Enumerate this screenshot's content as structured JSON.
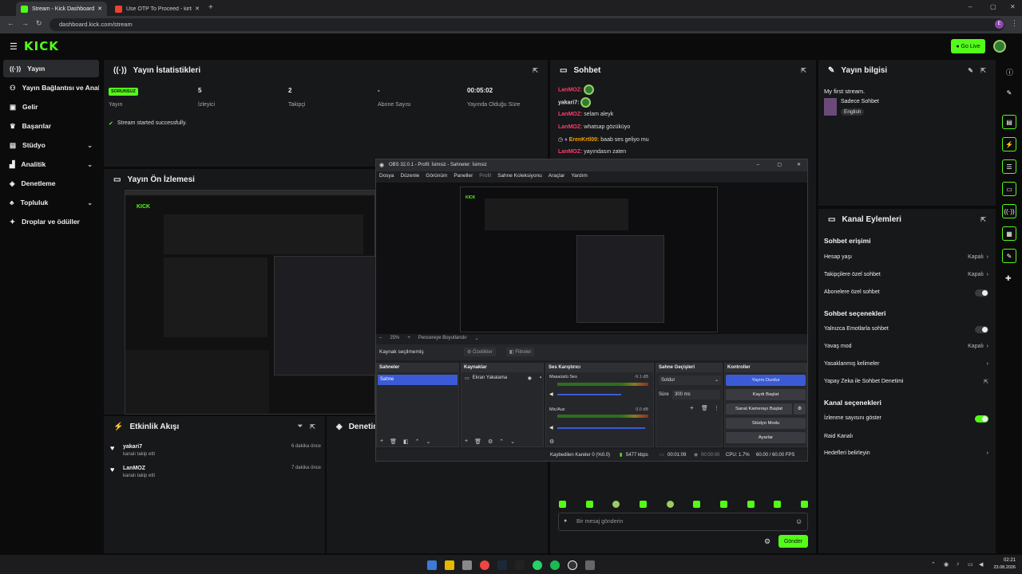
{
  "browser": {
    "tabs": [
      {
        "title": "Stream - Kick Dashboard"
      },
      {
        "title": "Use OTP To Proceed - kirtileren..."
      }
    ],
    "url": "dashboard.kick.com/stream",
    "profile_initial": "E"
  },
  "header": {
    "logo": "KICK",
    "go_live": "Go Live"
  },
  "sidebar": {
    "items": [
      {
        "label": "Yayın",
        "icon": "broadcast-icon"
      },
      {
        "label": "Yayın Bağlantısı ve Anahtar",
        "icon": "link-icon"
      },
      {
        "label": "Gelir",
        "icon": "money-icon"
      },
      {
        "label": "Başarılar",
        "icon": "trophy-icon"
      },
      {
        "label": "Stüdyo",
        "icon": "studio-icon"
      },
      {
        "label": "Analitik",
        "icon": "chart-icon"
      },
      {
        "label": "Denetleme",
        "icon": "shield-icon"
      },
      {
        "label": "Topluluk",
        "icon": "community-icon"
      },
      {
        "label": "Droplar ve ödüller",
        "icon": "gift-icon"
      }
    ]
  },
  "stats": {
    "title": "Yayın İstatistikleri",
    "status_badge": "SORUNSUZ",
    "items": [
      {
        "value": "",
        "label": "Yayın"
      },
      {
        "value": "5",
        "label": "İzleyici"
      },
      {
        "value": "2",
        "label": "Takipçi"
      },
      {
        "value": "-",
        "label": "Abone Sayısı"
      },
      {
        "value": "00:05:02",
        "label": "Yayında Olduğu Süre"
      }
    ],
    "message": "Stream started successfully."
  },
  "preview": {
    "title": "Yayın Ön İzlemesi"
  },
  "activity": {
    "title": "Etkinlik Akışı",
    "items": [
      {
        "user": "yakari7",
        "desc": "kanalı takip etti",
        "time": "6 dakika önce"
      },
      {
        "user": "LanMOZ",
        "desc": "kanalı takip etti",
        "time": "7 dakika önce"
      }
    ]
  },
  "moderation": {
    "title": "Denetim"
  },
  "chat": {
    "title": "Sohbet",
    "lines": [
      {
        "user": "LanMOZ:",
        "text": ""
      },
      {
        "user": "yakari7:",
        "text": ""
      },
      {
        "user": "LanMOZ:",
        "text": "selam aleyk"
      },
      {
        "user": "LanMOZ:",
        "text": "whatsap gözüküyo"
      },
      {
        "user": "ErenKrtl00:",
        "text": "baab ses geliyo mu"
      },
      {
        "user": "LanMOZ:",
        "text": "yayındasın zaten"
      }
    ],
    "input_placeholder": "Bir mesaj gönderin",
    "send_label": "Gönder"
  },
  "stream_info": {
    "title": "Yayın bilgisi",
    "stream_title": "My first stream.",
    "category": "Sadece Sohbet",
    "language": "English"
  },
  "channel_actions": {
    "title": "Kanal Eylemleri",
    "sections": [
      {
        "heading": "Sohbet erişimi",
        "rows": [
          {
            "label": "Hesap yaşı",
            "value": "Kapalı",
            "kind": "arrow"
          },
          {
            "label": "Takipçilere özel sohbet",
            "value": "Kapalı",
            "kind": "arrow"
          },
          {
            "label": "Abonelere özel sohbet",
            "value": "",
            "kind": "toggle-off"
          }
        ]
      },
      {
        "heading": "Sohbet seçenekleri",
        "rows": [
          {
            "label": "Yalnızca Emotlarla sohbet",
            "value": "",
            "kind": "toggle-off"
          },
          {
            "label": "Yavaş mod",
            "value": "Kapalı",
            "kind": "arrow"
          },
          {
            "label": "Yasaklanmış kelimeler",
            "value": "",
            "kind": "arrow"
          },
          {
            "label": "Yapay Zeka ile Sohbet Denetimi",
            "value": "",
            "kind": "ext"
          }
        ]
      },
      {
        "heading": "Kanal seçenekleri",
        "rows": [
          {
            "label": "İzlenme sayısını göster",
            "value": "",
            "kind": "toggle-on"
          },
          {
            "label": "Raid Kanalı",
            "value": "",
            "kind": "none"
          },
          {
            "label": "Hedefleri belirleyin",
            "value": "",
            "kind": "arrow"
          }
        ]
      }
    ]
  },
  "obs": {
    "title": "OBS 32.0.1 - Profil: İsimsiz - Sahneler: İsimsiz",
    "menu": [
      "Dosya",
      "Düzenle",
      "Görünüm",
      "Paneller",
      "Profil",
      "Sahne Koleksiyonu",
      "Araçlar",
      "Yardım"
    ],
    "zoom": "25%",
    "resize_label": "Pencereye Boyutlandır",
    "source_none": "Kaynak seçilmemiş",
    "props": "Özellikler",
    "filters": "Filtreler",
    "docks": {
      "scenes": "Sahneler",
      "scene_item": "Sahne",
      "sources": "Kaynaklar",
      "source_item": "Ekran Yakalama",
      "mixer": "Ses Karıştırıcı",
      "ch1": "Masaüstü Ses",
      "ch1_db": "-9.1 dB",
      "ch2": "Mic/Aux",
      "ch2_db": "0.0 dB",
      "transitions": "Sahne Geçişleri",
      "transition": "Soldur",
      "duration_label": "Süre",
      "duration": "300 ms",
      "controls": "Kontroller"
    },
    "buttons": [
      "Yayını Durdur",
      "Kaydı Başlat",
      "Sanal Kamerayı Başlat",
      "Stüdyo Modu",
      "Ayarlar"
    ],
    "status": {
      "dropped": "Kaybedilen Kareler 0 (%0.0)",
      "bitrate": "5477 kbps",
      "time": "00:01:09",
      "time2": "00:00:00",
      "cpu": "CPU: 1.7%",
      "fps": "60.00 / 60.00 FPS"
    }
  },
  "taskbar": {
    "time": "02:21",
    "date": "23.08.2026"
  }
}
